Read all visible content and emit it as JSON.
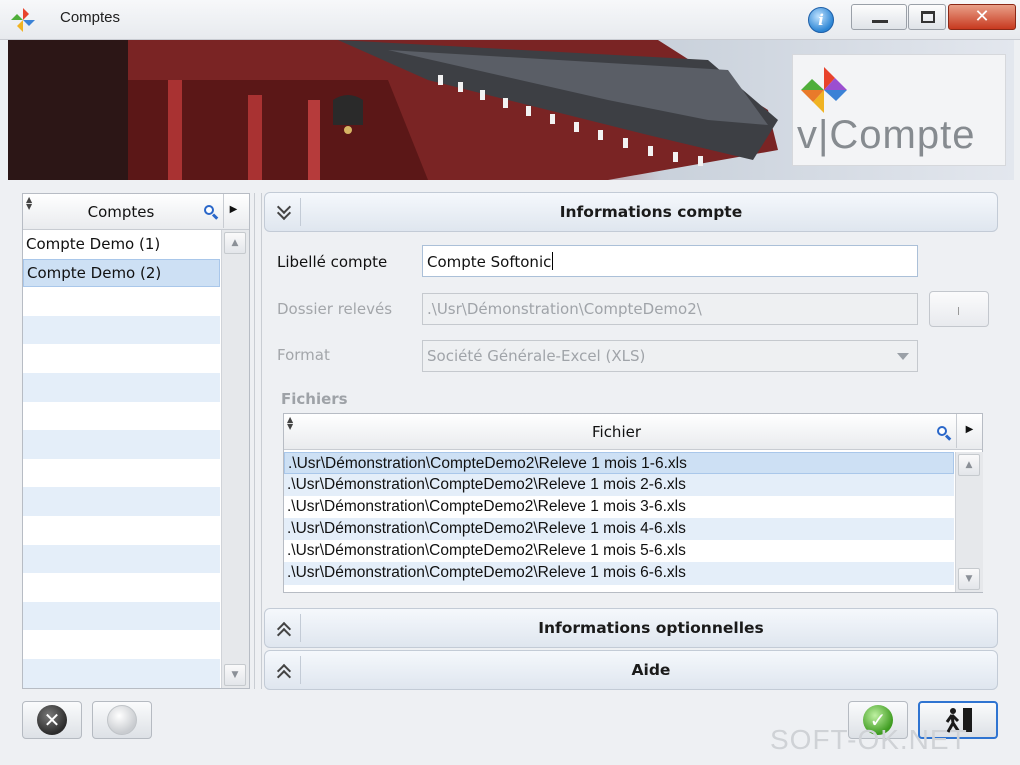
{
  "window": {
    "title": "Comptes",
    "info_icon": "info-icon",
    "colors": {
      "title_bar": "#eceef1",
      "close_button": "#c7391f",
      "selection": "#cde0f4",
      "stripe": "#e4eef9"
    }
  },
  "banner": {
    "brand_text": "v|Compte",
    "logo_icon": "pinwheel-logo"
  },
  "accounts_panel": {
    "column_header": "Comptes",
    "items": [
      {
        "label": "Compte Demo (1)",
        "selected": false
      },
      {
        "label": "Compte Demo (2)",
        "selected": true
      }
    ],
    "up_arrow": "▲",
    "down_arrow": "▼"
  },
  "sections": {
    "info_compte": "Informations compte",
    "info_optionnelles": "Informations optionnelles",
    "aide": "Aide"
  },
  "form": {
    "libelle_label": "Libellé compte",
    "libelle_value": "Compte Softonic",
    "dossier_label": "Dossier relevés",
    "dossier_value": ".\\Usr\\Démonstration\\CompteDemo2\\",
    "format_label": "Format",
    "format_value": "Société Générale-Excel (XLS)"
  },
  "files": {
    "group_label": "Fichiers",
    "column_header": "Fichier",
    "items": [
      ".\\Usr\\Démonstration\\CompteDemo2\\Releve 1 mois 1-6.xls",
      ".\\Usr\\Démonstration\\CompteDemo2\\Releve 1 mois 2-6.xls",
      ".\\Usr\\Démonstration\\CompteDemo2\\Releve 1 mois 3-6.xls",
      ".\\Usr\\Démonstration\\CompteDemo2\\Releve 1 mois 4-6.xls",
      ".\\Usr\\Démonstration\\CompteDemo2\\Releve 1 mois 5-6.xls",
      ".\\Usr\\Démonstration\\CompteDemo2\\Releve 1 mois 6-6.xls"
    ]
  },
  "buttons": {
    "delete_icon": "cancel-icon",
    "refresh_icon": "refresh-icon",
    "validate_icon": "check-icon",
    "exit_icon": "exit-door-icon",
    "close_glyph": "✕",
    "check_glyph": "✓",
    "cancel_glyph": "✕"
  },
  "watermark": "SOFT-OK.NET"
}
